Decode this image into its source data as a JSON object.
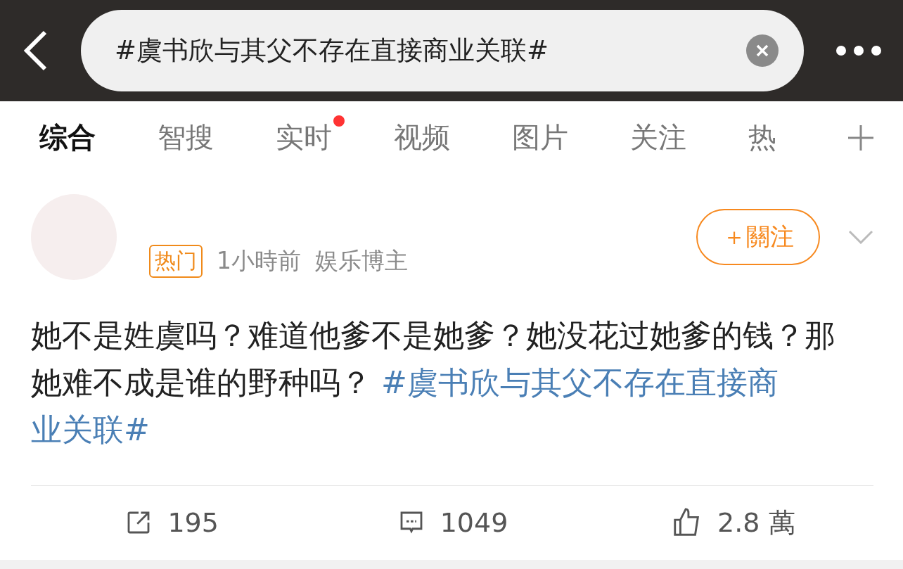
{
  "search": {
    "value": "#虞书欣与其父不存在直接商业关联#"
  },
  "tabs": [
    {
      "label": "综合",
      "selected": true,
      "dot": false
    },
    {
      "label": "智搜",
      "selected": false,
      "dot": false
    },
    {
      "label": "实时",
      "selected": false,
      "dot": true
    },
    {
      "label": "视频",
      "selected": false,
      "dot": false
    },
    {
      "label": "图片",
      "selected": false,
      "dot": false
    },
    {
      "label": "关注",
      "selected": false,
      "dot": false
    },
    {
      "label": "热",
      "selected": false,
      "dot": false
    }
  ],
  "post": {
    "tag": "热门",
    "time": "1小時前",
    "source": "娱乐博主",
    "follow": "＋關注",
    "text": "她不是姓虞吗？难道他爹不是她爹？她没花过她爹的钱？那她难不成是谁的野种吗？ ",
    "hashtag_lines": [
      "#虞书欣与其父不存在直接商",
      "业关联#"
    ],
    "actions": [
      {
        "kind": "repost",
        "count": "195"
      },
      {
        "kind": "comment",
        "count": "1049"
      },
      {
        "kind": "like",
        "count": "2.8 萬"
      }
    ]
  }
}
